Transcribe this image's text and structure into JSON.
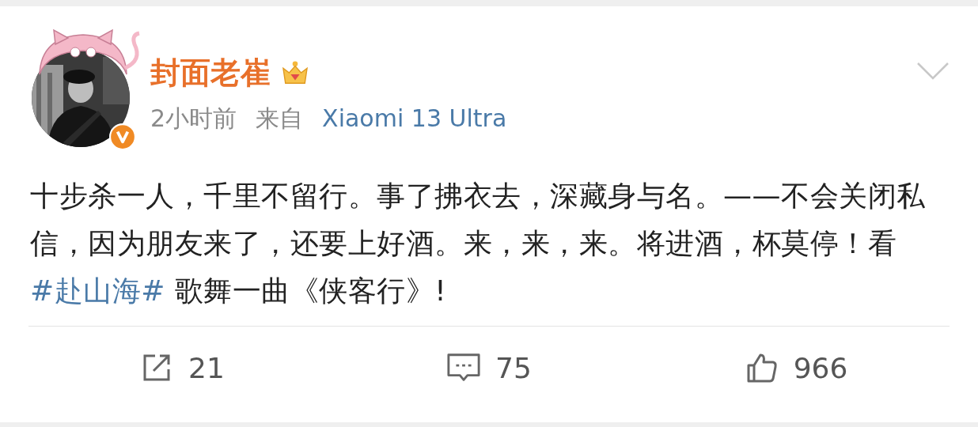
{
  "post": {
    "author": {
      "name": "封面老崔",
      "verified": true,
      "crown": true
    },
    "time": "2小时前",
    "source_label": "来自",
    "source": "Xiaomi 13 Ultra",
    "body": [
      {
        "kind": "text",
        "text": "十步杀一人，千里不留行。事了拂衣去，深藏身与名。——不会关闭私信，因为朋友来了，还要上好酒。来，来，来。将进酒，杯莫停！看"
      },
      {
        "kind": "hashtag",
        "text": "#赴山海#"
      },
      {
        "kind": "text",
        "text": " 歌舞一曲《侠客行》!"
      }
    ],
    "actions": [
      {
        "kind": "repost",
        "count": "21"
      },
      {
        "kind": "comment",
        "count": "75"
      },
      {
        "kind": "like",
        "count": "966"
      }
    ]
  }
}
